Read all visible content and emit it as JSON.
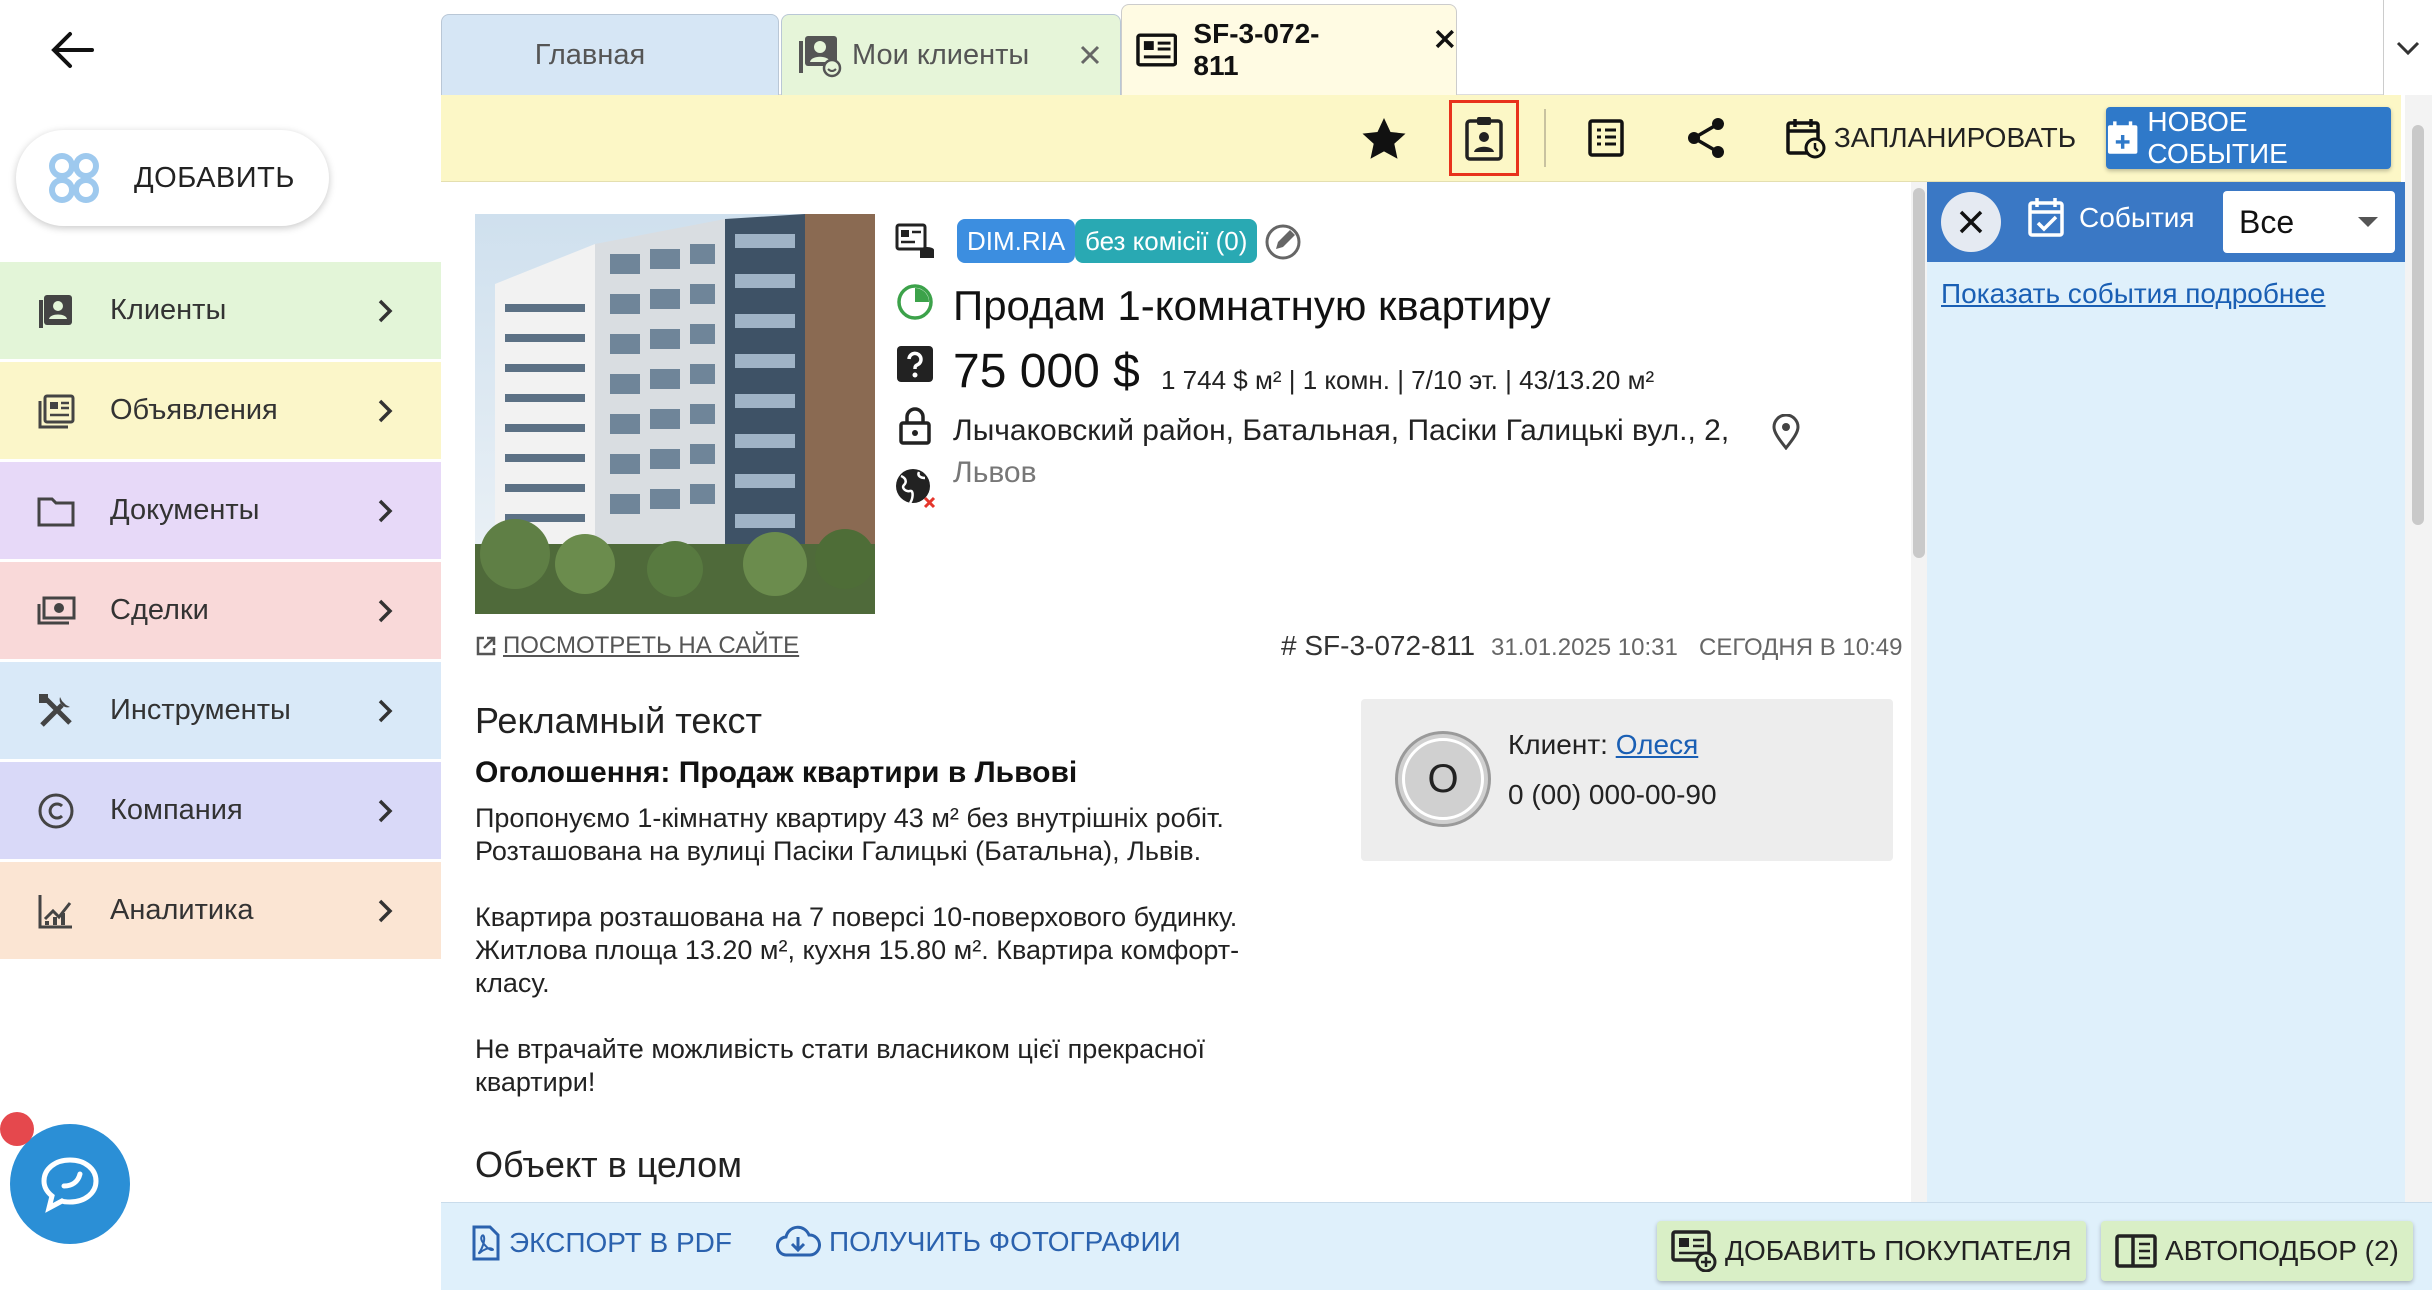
{
  "sidebar": {
    "add_label": "ДОБАВИТЬ",
    "items": [
      {
        "label": "Клиенты",
        "icon": "contacts-icon",
        "color": "#e3f5d8"
      },
      {
        "label": "Объявления",
        "icon": "listings-icon",
        "color": "#fbf6c9"
      },
      {
        "label": "Документы",
        "icon": "folder-icon",
        "color": "#e7d9f8"
      },
      {
        "label": "Сделки",
        "icon": "money-icon",
        "color": "#f9d9d9"
      },
      {
        "label": "Инструменты",
        "icon": "tools-icon",
        "color": "#d9e9f8"
      },
      {
        "label": "Компания",
        "icon": "copyright-icon",
        "color": "#d9d9f8"
      },
      {
        "label": "Аналитика",
        "icon": "analytics-icon",
        "color": "#fbe5d3"
      }
    ]
  },
  "tabs": {
    "home": "Главная",
    "clients": "Мои клиенты",
    "listing": "SF-3-072-811"
  },
  "toolbar": {
    "schedule": "ЗАПЛАНИРОВАТЬ",
    "new_event": "НОВОЕ СОБЫТИЕ"
  },
  "listing": {
    "source_badge": "DIM.RIA",
    "commission_badge": "без комісії (0)",
    "title": "Продам 1-комнатную квартиру",
    "price": "75 000 $",
    "details": "1 744 $ м² | 1 комн. | 7/10 эт. | 43/13.20 м²",
    "address": "Лычаковский район, Батальная, Пасіки Галицькі вул., 2,",
    "city": "Львов",
    "view_on_site": "ПОСМОТРЕТЬ НА САЙТЕ",
    "id": "# SF-3-072-811",
    "created": "31.01.2025 10:31",
    "updated": "СЕГОДНЯ В 10:49"
  },
  "ad": {
    "heading": "Рекламный текст",
    "subtitle": "Оголошення: Продаж квартири в Львові",
    "body": "Пропонуємо 1-кімнатну квартиру 43 м² без внутрішніх робіт.\nРозташована на вулиці Пасіки Галицькі (Батальна), Львів.\n\nКвартира розташована на 7 поверсі 10-поверхового будинку.\nЖитлова площа 13.20 м², кухня 15.80 м². Квартира комфорт-\nкласу.\n\nНе втрачайте можливість стати власником цієї прекрасної\nквартири!",
    "object_heading": "Объект в целом"
  },
  "client": {
    "initial": "О",
    "label": "Клиент:",
    "name": "Олеся",
    "phone": "0 (00) 000-00-90"
  },
  "events": {
    "title": "События",
    "filter": "Все",
    "detail_link": "Показать события подробнее"
  },
  "bottom": {
    "export_pdf": "ЭКСПОРТ В PDF",
    "get_photos": "ПОЛУЧИТЬ ФОТОГРАФИИ",
    "add_buyer": "ДОБАВИТЬ ПОКУПАТЕЛЯ",
    "auto_match": "АВТОПОДБОР (2)"
  },
  "colors": {
    "accent": "#2f79c9",
    "toolbar_bg": "#fcf7c6",
    "highlight": "#e8321c"
  }
}
